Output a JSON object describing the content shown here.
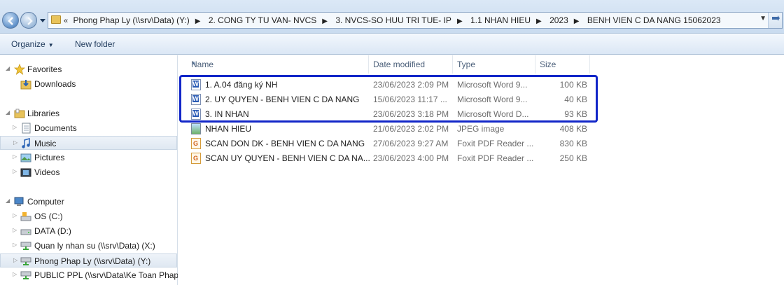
{
  "address": {
    "overflow": "«",
    "crumbs": [
      "Phong Phap Ly (\\\\srv\\Data) (Y:)",
      "2. CONG TY TU VAN- NVCS",
      "3. NVCS-SO HUU TRI TUE- IP",
      "1.1 NHAN HIEU",
      "2023",
      "BENH VIEN C DA NANG 15062023"
    ]
  },
  "toolbar": {
    "organize_label": "Organize",
    "new_folder_label": "New folder"
  },
  "nav": {
    "favorites": "Favorites",
    "downloads": "Downloads",
    "libraries": "Libraries",
    "documents": "Documents",
    "music": "Music",
    "pictures": "Pictures",
    "videos": "Videos",
    "computer": "Computer",
    "drive_c": "OS (C:)",
    "drive_d": "DATA (D:)",
    "drive_x": "Quan ly nhan su (\\\\srv\\Data) (X:)",
    "drive_y": "Phong Phap Ly (\\\\srv\\Data) (Y:)",
    "drive_public": "PUBLIC PPL (\\\\srv\\Data\\Ke Toan Phap"
  },
  "columns": {
    "name": "Name",
    "date": "Date modified",
    "type": "Type",
    "size": "Size"
  },
  "files": [
    {
      "name": "1. A.04 đăng ký NH",
      "date": "23/06/2023 2:09 PM",
      "type": "Microsoft Word 9...",
      "size": "100 KB",
      "icon": "word-doc-icon"
    },
    {
      "name": "2. UY QUYEN - BENH VIEN C DA NANG",
      "date": "15/06/2023 11:17 ...",
      "type": "Microsoft Word 9...",
      "size": "40 KB",
      "icon": "word-doc-icon"
    },
    {
      "name": "3. IN NHAN",
      "date": "23/06/2023 3:18 PM",
      "type": "Microsoft Word D...",
      "size": "93 KB",
      "icon": "word-doc-icon"
    },
    {
      "name": "NHAN HIEU",
      "date": "21/06/2023 2:02 PM",
      "type": "JPEG image",
      "size": "408 KB",
      "icon": "jpeg-icon"
    },
    {
      "name": "SCAN DON DK - BENH VIEN C DA NANG",
      "date": "27/06/2023 9:27 AM",
      "type": "Foxit PDF Reader ...",
      "size": "830 KB",
      "icon": "pdf-icon"
    },
    {
      "name": "SCAN UY QUYEN - BENH VIEN C DA NA...",
      "date": "23/06/2023 4:00 PM",
      "type": "Foxit PDF Reader ...",
      "size": "250 KB",
      "icon": "pdf-icon"
    }
  ]
}
